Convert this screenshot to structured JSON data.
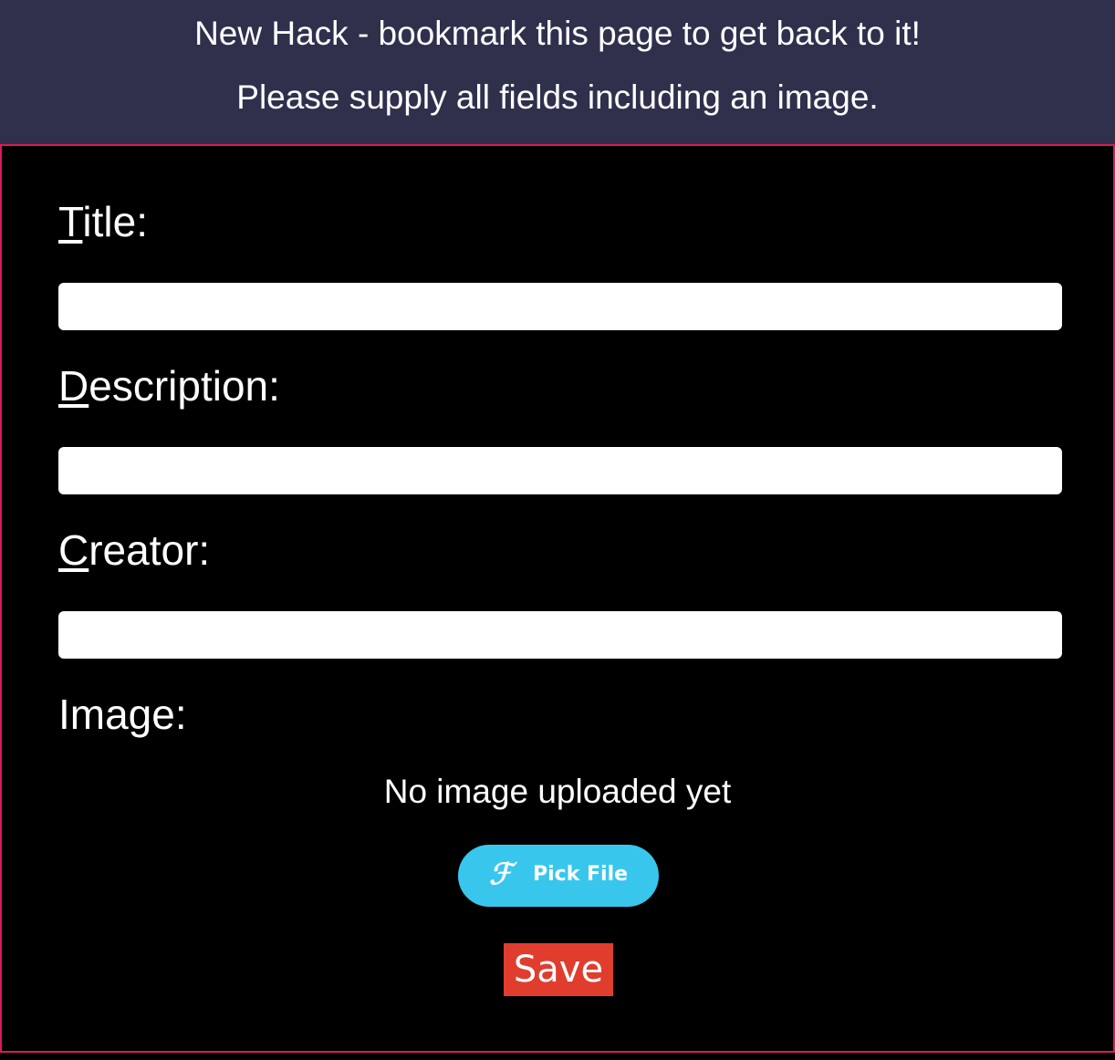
{
  "header": {
    "line1": "New Hack - bookmark this page to get back to it!",
    "line2": "Please supply all fields including an image."
  },
  "form": {
    "title": {
      "accesskey": "T",
      "label_rest": "itle:",
      "value": ""
    },
    "description": {
      "accesskey": "D",
      "label_rest": "escription:",
      "value": ""
    },
    "creator": {
      "accesskey": "C",
      "label_rest": "reator:",
      "value": ""
    },
    "image": {
      "label": "Image:",
      "status": "No image uploaded yet",
      "pick_icon": "filestack-f-icon",
      "pick_label": "Pick File"
    },
    "save_label": "Save"
  },
  "colors": {
    "header_bg": "#2e304c",
    "panel_border": "#d81b60",
    "pick_button": "#38c6ed",
    "save_button": "#e03d2f"
  }
}
